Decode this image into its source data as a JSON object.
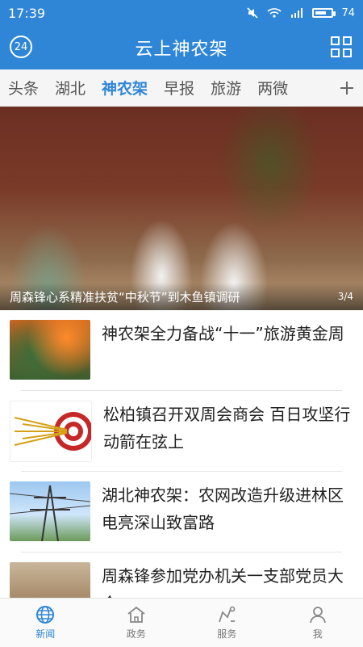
{
  "status": {
    "time": "17:39",
    "battery": "74",
    "battery_level": 0.74
  },
  "appbar": {
    "title": "云上神农架",
    "badge": "24"
  },
  "tabs": [
    "头条",
    "湖北",
    "神农架",
    "早报",
    "旅游",
    "两微"
  ],
  "hero": {
    "caption": "周森锋心系精准扶贫“中秋节”到木鱼镇调研",
    "counter": "3/4"
  },
  "news": [
    {
      "title": "神农架全力备战“十一”旅游黄金周"
    },
    {
      "title": "松柏镇召开双周会商会 百日攻坚行动箭在弦上"
    },
    {
      "title": "湖北神农架：农网改造升级进林区 电亮深山致富路"
    },
    {
      "title": "周森锋参加党办机关一支部党员大会"
    }
  ],
  "bottom_nav": [
    {
      "label": "新闻",
      "icon": "globe-icon",
      "active": true
    },
    {
      "label": "政务",
      "icon": "government-icon",
      "active": false
    },
    {
      "label": "服务",
      "icon": "services-icon",
      "active": false
    },
    {
      "label": "我",
      "icon": "profile-icon",
      "active": false
    }
  ],
  "colors": {
    "primary": "#2f86d6",
    "tab_bg": "#f5f5f5",
    "nav_bg": "#fafafa"
  }
}
